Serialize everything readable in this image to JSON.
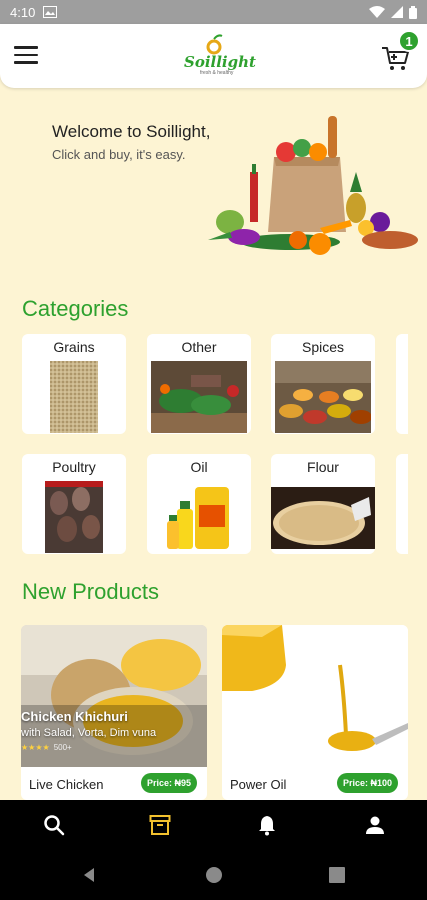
{
  "status_bar": {
    "time": "4:10"
  },
  "app_bar": {
    "logo_text": "Soillight",
    "logo_tagline": "fresh & healthy",
    "cart_count": "1"
  },
  "welcome": {
    "title": "Welcome to Soillight,",
    "subtitle": "Click and buy, it's easy."
  },
  "categories": {
    "title": "Categories",
    "items": [
      {
        "label": "Grains"
      },
      {
        "label": "Other"
      },
      {
        "label": "Spices"
      },
      {
        "label": "Poultry"
      },
      {
        "label": "Oil"
      },
      {
        "label": "Flour"
      }
    ]
  },
  "new_products": {
    "title": "New Products",
    "items": [
      {
        "name": "Live Chicken",
        "price": "Price: ₦95",
        "overlay_title": "Chicken Khichuri",
        "overlay_subtitle": "with Salad, Vorta, Dim vuna",
        "overlay_rating": "★★★★",
        "overlay_count": "500+"
      },
      {
        "name": "Power Oil",
        "price": "Price: ₦100"
      }
    ]
  },
  "colors": {
    "brand_green": "#2ea12e",
    "background": "#fdf4d3",
    "active_nav": "#f2c12e"
  },
  "bottom_nav": {
    "items": [
      {
        "icon": "search-icon"
      },
      {
        "icon": "archive-icon",
        "active": true
      },
      {
        "icon": "bell-icon"
      },
      {
        "icon": "person-icon"
      }
    ]
  }
}
